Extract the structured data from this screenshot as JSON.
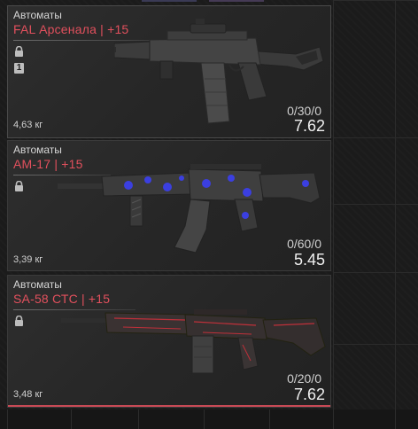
{
  "weapons": [
    {
      "category": "Автоматы",
      "name": "FAL Арсенала | +15",
      "badge": "1",
      "weight": "4,63 кг",
      "ammo": "0/30/0",
      "caliber": "7.62"
    },
    {
      "category": "Автоматы",
      "name": "АМ-17 | +15",
      "weight": "3,39 кг",
      "ammo": "0/60/0",
      "caliber": "5.45"
    },
    {
      "category": "Автоматы",
      "name": "SA-58 СТС | +15",
      "weight": "3,48 кг",
      "ammo": "0/20/0",
      "caliber": "7.62"
    }
  ],
  "colors": {
    "accent": "#e2505d",
    "underline": "#c94a56",
    "camo_blue": "#3b3fe0",
    "camo_red": "#c0303a"
  },
  "icons": [
    "lock-icon",
    "rank-badge-icon",
    "weapon-fal-image",
    "weapon-am17-image",
    "weapon-sa58-image"
  ]
}
